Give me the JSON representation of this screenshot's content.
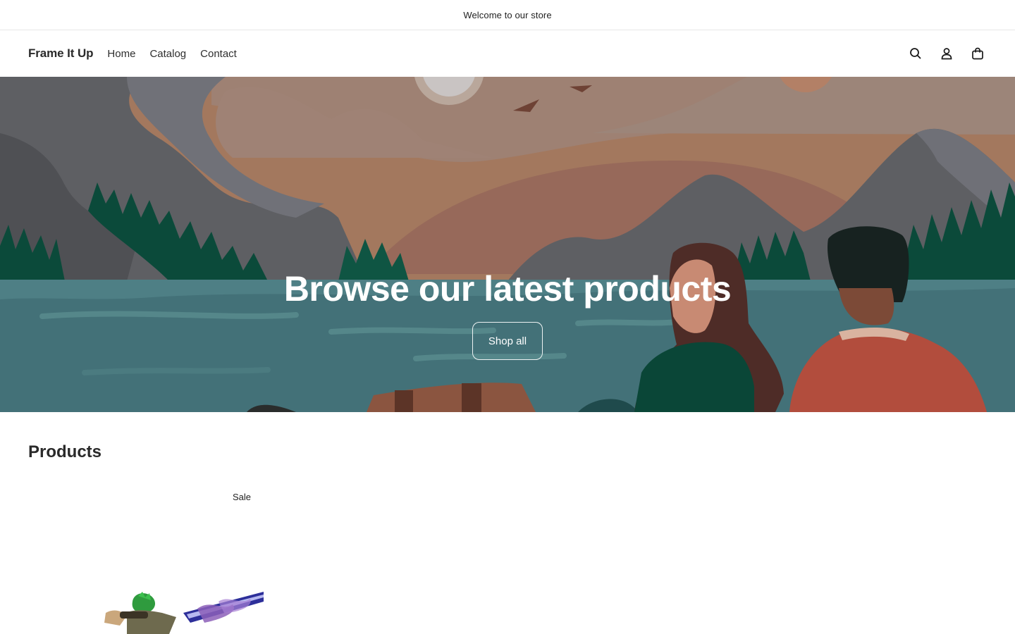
{
  "announcement": {
    "text": "Welcome to our store"
  },
  "header": {
    "logo": "Frame It Up",
    "nav": [
      {
        "label": "Home"
      },
      {
        "label": "Catalog"
      },
      {
        "label": "Contact"
      }
    ],
    "icons": [
      "search-icon",
      "account-icon",
      "cart-icon"
    ]
  },
  "hero": {
    "title": "Browse our latest products",
    "button_label": "Shop all"
  },
  "products": {
    "heading": "Products",
    "items": [
      {
        "badge": "Sale"
      }
    ]
  },
  "colors": {
    "sky": "#a3785e",
    "water": "#437178",
    "trees": "#0b4a3a",
    "mountain": "#5e5f63"
  }
}
